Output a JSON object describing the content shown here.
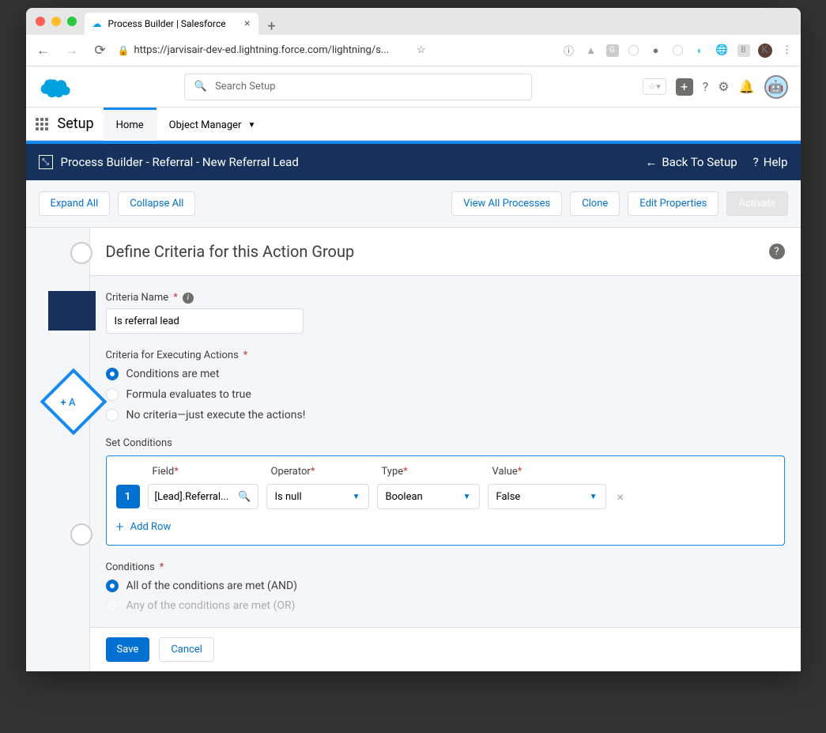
{
  "browser": {
    "tab_title": "Process Builder | Salesforce",
    "url": "https://jarvisair-dev-ed.lightning.force.com/lightning/s...",
    "avatar_letter": "K"
  },
  "sf_header": {
    "search_placeholder": "Search Setup"
  },
  "setup_nav": {
    "label": "Setup",
    "home": "Home",
    "object_manager": "Object Manager"
  },
  "pb_header": {
    "title": "Process Builder - Referral - New Referral Lead",
    "back": "Back To Setup",
    "help": "Help"
  },
  "toolbar": {
    "expand": "Expand All",
    "collapse": "Collapse All",
    "view_all": "View All Processes",
    "clone": "Clone",
    "edit_props": "Edit Properties",
    "activate": "Activate"
  },
  "canvas": {
    "add_label": "A"
  },
  "panel": {
    "title": "Define Criteria for this Action Group",
    "criteria_name_label": "Criteria Name",
    "criteria_name_value": "Is referral lead",
    "exec_label": "Criteria for Executing Actions",
    "radio1": "Conditions are met",
    "radio2": "Formula evaluates to true",
    "radio3": "No criteria—just execute the actions!",
    "set_conditions": "Set Conditions",
    "col_field": "Field",
    "col_operator": "Operator",
    "col_type": "Type",
    "col_value": "Value",
    "row_num": "1",
    "field_value": "[Lead].Referral...",
    "operator_value": "Is null",
    "type_value": "Boolean",
    "value_value": "False",
    "add_row": "Add Row",
    "conditions_label": "Conditions",
    "cond_radio1": "All of the conditions are met (AND)",
    "cond_radio2": "Any of the conditions are met (OR)",
    "save": "Save",
    "cancel": "Cancel"
  }
}
